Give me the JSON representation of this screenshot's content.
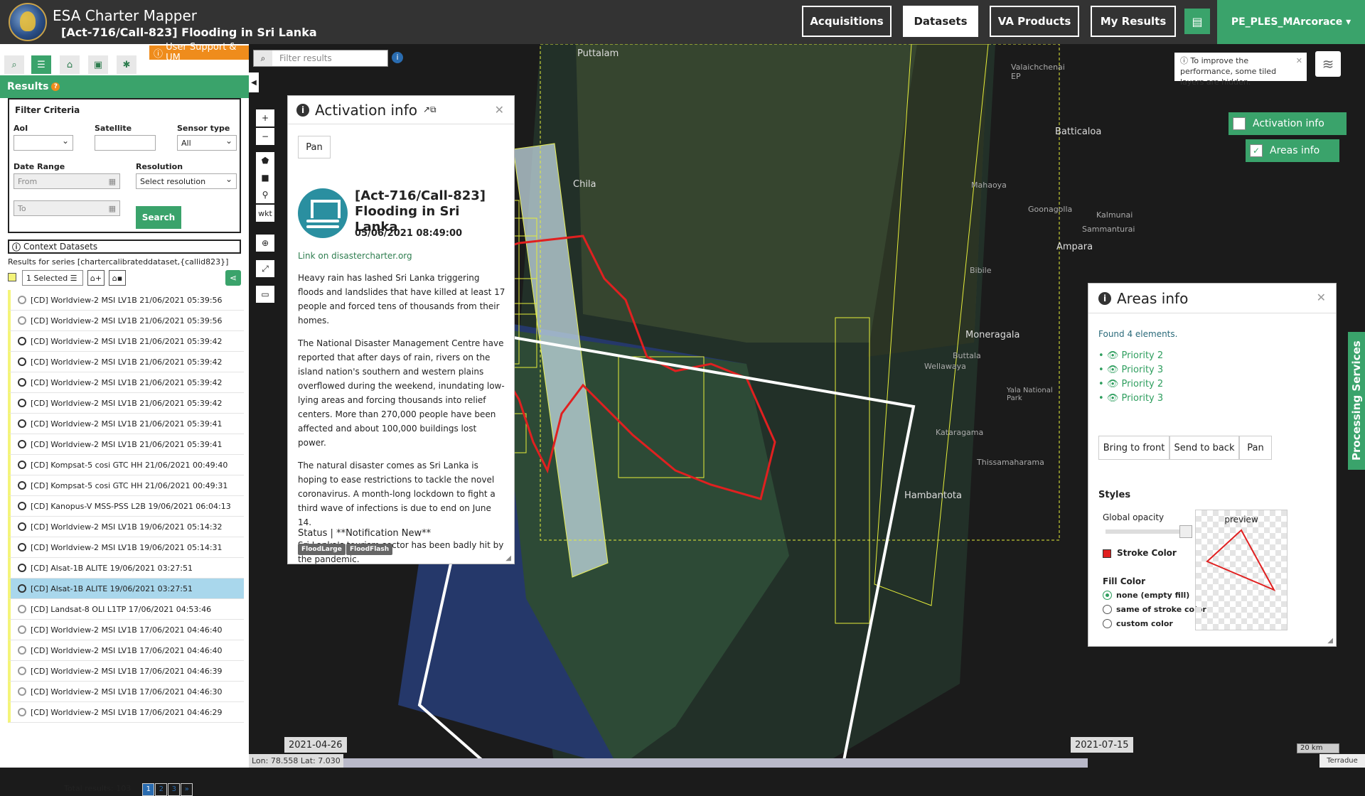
{
  "header": {
    "app_title": "ESA Charter Mapper",
    "subtitle": "[Act-716/Call-823] Flooding in Sri Lanka",
    "nav": [
      "Acquisitions",
      "Datasets",
      "VA Products",
      "My Results"
    ],
    "active_nav": "Datasets",
    "user": "PE_PLES_MArcorace ▾"
  },
  "sidebar": {
    "support_label": "User Support & UM",
    "results_title": "Results",
    "filter": {
      "title": "Filter Criteria",
      "aoi_label": "AoI",
      "satellite_label": "Satellite",
      "sensor_label": "Sensor type",
      "sensor_value": "All",
      "date_label": "Date Range",
      "from_placeholder": "From",
      "to_placeholder": "To",
      "resolution_label": "Resolution",
      "resolution_value": "Select resolution",
      "search_label": "Search"
    },
    "context_label": "Context Datasets",
    "series_text": "Results for series [chartercalibrateddataset,{callid823}]",
    "selected_label": "1 Selected ☰",
    "results": [
      {
        "label": "[CD] Worldview-2 MSI LV1B 21/06/2021 05:39:56",
        "grey": true
      },
      {
        "label": "[CD] Worldview-2 MSI LV1B 21/06/2021 05:39:56",
        "grey": true
      },
      {
        "label": "[CD] Worldview-2 MSI LV1B 21/06/2021 05:39:42",
        "grey": false
      },
      {
        "label": "[CD] Worldview-2 MSI LV1B 21/06/2021 05:39:42",
        "grey": false
      },
      {
        "label": "[CD] Worldview-2 MSI LV1B 21/06/2021 05:39:42",
        "grey": false
      },
      {
        "label": "[CD] Worldview-2 MSI LV1B 21/06/2021 05:39:42",
        "grey": false
      },
      {
        "label": "[CD] Worldview-2 MSI LV1B 21/06/2021 05:39:41",
        "grey": false
      },
      {
        "label": "[CD] Worldview-2 MSI LV1B 21/06/2021 05:39:41",
        "grey": false
      },
      {
        "label": "[CD] Kompsat-5 cosi GTC HH 21/06/2021 00:49:40",
        "grey": false
      },
      {
        "label": "[CD] Kompsat-5 cosi GTC HH 21/06/2021 00:49:31",
        "grey": false
      },
      {
        "label": "[CD] Kanopus-V MSS-PSS L2B 19/06/2021 06:04:13",
        "grey": false
      },
      {
        "label": "[CD] Worldview-2 MSI LV1B 19/06/2021 05:14:32",
        "grey": false
      },
      {
        "label": "[CD] Worldview-2 MSI LV1B 19/06/2021 05:14:31",
        "grey": false
      },
      {
        "label": "[CD] Alsat-1B ALITE 19/06/2021 03:27:51",
        "grey": false
      },
      {
        "label": "[CD] Alsat-1B ALITE 19/06/2021 03:27:51",
        "grey": false,
        "selected": true
      },
      {
        "label": "[CD] Landsat-8 OLI L1TP 17/06/2021 04:53:46",
        "grey": true
      },
      {
        "label": "[CD] Worldview-2 MSI LV1B 17/06/2021 04:46:40",
        "grey": true
      },
      {
        "label": "[CD] Worldview-2 MSI LV1B 17/06/2021 04:46:40",
        "grey": true
      },
      {
        "label": "[CD] Worldview-2 MSI LV1B 17/06/2021 04:46:39",
        "grey": true
      },
      {
        "label": "[CD] Worldview-2 MSI LV1B 17/06/2021 04:46:30",
        "grey": true
      },
      {
        "label": "[CD] Worldview-2 MSI LV1B 17/06/2021 04:46:29",
        "grey": true
      }
    ],
    "total_results": "Total results: 103",
    "pages": [
      "1",
      "2",
      "3",
      "»"
    ]
  },
  "map": {
    "filter_placeholder": "Filter results",
    "wkt_label": "wkt",
    "perf_note": "To improve the performance, some tiled layers are hidden.",
    "layer_toggles": {
      "activation": "Activation info",
      "areas": "Areas info"
    },
    "processing_label": "Processing Services",
    "places": [
      {
        "name": "Puttalam"
      },
      {
        "name": "Valaichchenai EP"
      },
      {
        "name": "Batticaloa"
      },
      {
        "name": "Mahaoya"
      },
      {
        "name": "Goonagolla"
      },
      {
        "name": "Kalmunai"
      },
      {
        "name": "Sammanturai"
      },
      {
        "name": "Ampara"
      },
      {
        "name": "Bibile"
      },
      {
        "name": "Moneragala"
      },
      {
        "name": "Buttala"
      },
      {
        "name": "Wellawaya"
      },
      {
        "name": "Yala National Park"
      },
      {
        "name": "Kataragama"
      },
      {
        "name": "Thissamaharama"
      },
      {
        "name": "Hambantota"
      },
      {
        "name": "Chila"
      }
    ],
    "coords": "Lon: 78.558 Lat: 7.030",
    "timeline_start": "2021-04-26",
    "timeline_end": "2021-07-15",
    "scale": "20 km",
    "attribution": "Terradue"
  },
  "activation_panel": {
    "title": "Activation info",
    "pan_label": "Pan",
    "act_title": "[Act-716/Call-823] Flooding in Sri Lanka",
    "date": "05/06/2021 08:49:00",
    "link": "Link on disastercharter.org",
    "paragraphs": [
      "Heavy rain has lashed Sri Lanka triggering floods and landslides that have killed at least 17 people and forced tens of thousands from their homes.",
      "The National Disaster Management Centre have reported that after days of rain, rivers on the island nation's southern and western plains overflowed during the weekend, inundating low-lying areas and forcing thousands into relief centers. More than 270,000 people have been affected and about 100,000 buildings lost power.",
      "The natural disaster comes as Sri Lanka is hoping to ease restrictions to tackle the novel coronavirus. A month-long lockdown to fight a third wave of infections is due to end on June 14.",
      "Sri Lanka's tourism sector has been badly hit by the pandemic."
    ],
    "status": "Status | **Notification New**",
    "tags": [
      "FloodLarge",
      "FloodFlash"
    ]
  },
  "areas_panel": {
    "title": "Areas info",
    "found": "Found 4 elements.",
    "priorities": [
      "Priority 2",
      "Priority 3",
      "Priority 2",
      "Priority 3"
    ],
    "buttons": [
      "Bring to front",
      "Send to back",
      "Pan"
    ],
    "styles_title": "Styles",
    "opacity_label": "Global opacity",
    "stroke_label": "Stroke Color",
    "fill_label": "Fill Color",
    "fill_options": [
      "none (empty fill)",
      "same of stroke color",
      "custom color"
    ],
    "preview_label": "preview"
  }
}
